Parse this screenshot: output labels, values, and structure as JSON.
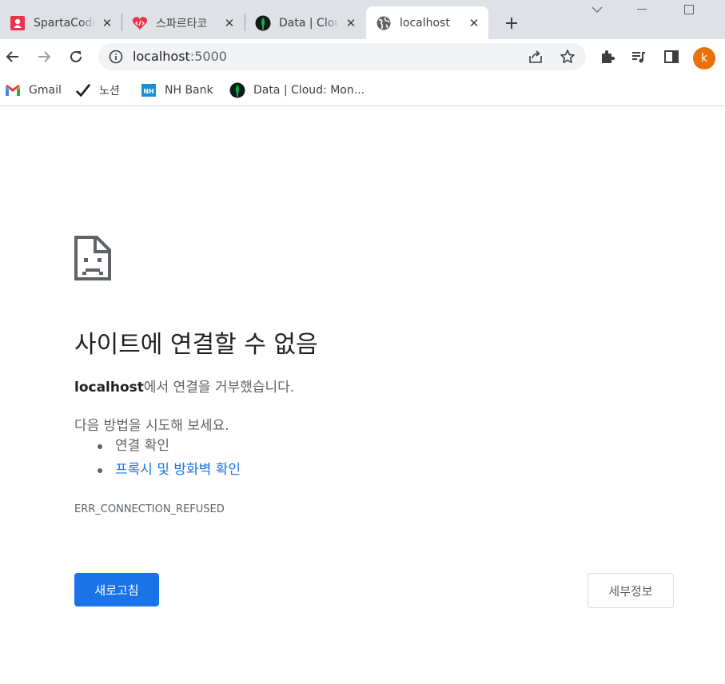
{
  "tabs": [
    {
      "title": "SpartaCodi",
      "favicon": "sparta-icon",
      "active": false
    },
    {
      "title": "스파르타코",
      "favicon": "sparta-heart-icon",
      "active": false
    },
    {
      "title": "Data | Clou",
      "favicon": "mongodb-leaf-icon",
      "active": false
    },
    {
      "title": "localhost",
      "favicon": "globe-icon",
      "active": true
    }
  ],
  "address_bar": {
    "host": "localhost",
    "port": ":5000"
  },
  "profile": {
    "initial": "k",
    "color": "#e8710a"
  },
  "bookmarks": [
    {
      "label": "Gmail",
      "icon": "gmail-icon"
    },
    {
      "label": "노션",
      "icon": "checkmark-icon"
    },
    {
      "label": "NH Bank",
      "icon": "nh-bank-icon"
    },
    {
      "label": "Data | Cloud: Mon...",
      "icon": "mongodb-leaf-icon"
    }
  ],
  "error_page": {
    "title": "사이트에 연결할 수 없음",
    "host": "localhost",
    "message_suffix": "에서 연결을 거부했습니다.",
    "try_heading": "다음 방법을 시도해 보세요.",
    "suggestions": [
      "연결 확인",
      "프록시 및 방화벽 확인"
    ],
    "error_code": "ERR_CONNECTION_REFUSED",
    "reload_label": "새로고침",
    "details_label": "세부정보"
  },
  "colors": {
    "accent": "#1a73e8",
    "tab_strip": "#dee1e6",
    "omnibox": "#f1f3f4"
  }
}
